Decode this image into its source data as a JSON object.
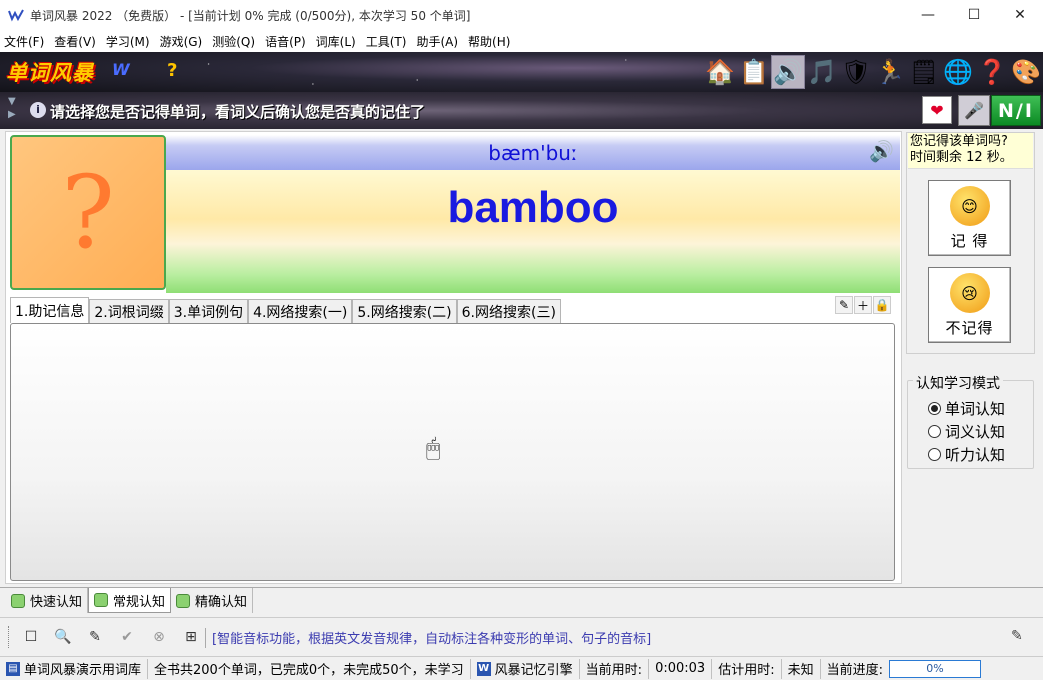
{
  "window": {
    "title": "单词风暴 2022 （免费版） - [当前计划 0% 完成 (0/500分), 本次学习 50 个单词]",
    "controls": {
      "minimize": "—",
      "maximize": "☐",
      "close": "✕"
    }
  },
  "menu": [
    "文件(F)",
    "查看(V)",
    "学习(M)",
    "游戏(G)",
    "测验(Q)",
    "语音(P)",
    "词库(L)",
    "工具(T)",
    "助手(A)",
    "帮助(H)"
  ],
  "banner": {
    "logo": "单词风暴",
    "logo_mark": "W",
    "help_glyph": "?",
    "tools": [
      {
        "name": "home-icon",
        "glyph": "🏠"
      },
      {
        "name": "list-icon",
        "glyph": "📋"
      },
      {
        "name": "speaker-icon",
        "glyph": "🔊"
      },
      {
        "name": "music-icon",
        "glyph": "🎵"
      },
      {
        "name": "shield-icon",
        "glyph": "🛡"
      },
      {
        "name": "runner-icon",
        "glyph": "🏃"
      },
      {
        "name": "notes-icon",
        "glyph": "🗒"
      },
      {
        "name": "globe-icon",
        "glyph": "🌐"
      },
      {
        "name": "help-icon",
        "glyph": "❓"
      },
      {
        "name": "palette-icon",
        "glyph": "🎨"
      }
    ]
  },
  "prompt": {
    "message": "请选择您是否记得单词，看词义后确认您是否真的记住了",
    "info_glyph": "i",
    "heart_glyph": "❤",
    "mic_glyph": "🎤",
    "ni_label": "N/I"
  },
  "word": {
    "card_glyph": "?",
    "phonetic": "bæm'buː",
    "text": "bamboo"
  },
  "tabs": [
    "1.助记信息",
    "2.词根词缀",
    "3.单词例句",
    "4.网络搜索(一)",
    "5.网络搜索(二)",
    "6.网络搜索(三)"
  ],
  "side": {
    "question_line1": "您记得该单词吗?",
    "question_line2": "时间剩余 12 秒。",
    "remember_label": "记 得",
    "forgot_label": "不记得",
    "remember_face": "😊",
    "forgot_face": "😢",
    "mode_title": "认知学习模式",
    "modes": [
      {
        "label": "单词认知",
        "selected": true
      },
      {
        "label": "词义认知",
        "selected": false
      },
      {
        "label": "听力认知",
        "selected": false
      }
    ]
  },
  "cognition_tabs": [
    {
      "label": "快速认知",
      "active": false
    },
    {
      "label": "常规认知",
      "active": true
    },
    {
      "label": "精确认知",
      "active": false
    }
  ],
  "toolbar": {
    "hint": "[智能音标功能，根据英文发音规律，自动标注各种变形的单词、句子的音标]"
  },
  "status": {
    "library": "单词风暴演示用词库",
    "summary": "全书共200个单词，已完成0个，未完成50个，未学习",
    "engine": "风暴记忆引擎",
    "time_label": "当前用时:",
    "time_value": "0:00:03",
    "est_label": "估计用时:",
    "est_value": "未知",
    "progress_label": "当前进度:",
    "progress_value": "0%",
    "progress_fraction": 0
  }
}
